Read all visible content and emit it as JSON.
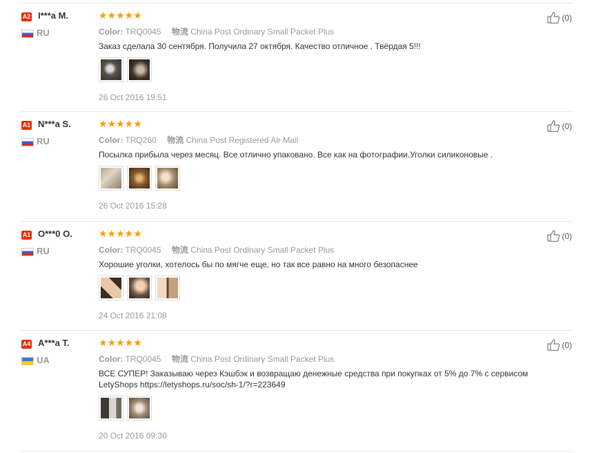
{
  "reviews": [
    {
      "badge": "A2",
      "buyer": "I***a M.",
      "country": "RU",
      "stars": "★★★★★",
      "color_label": "Color:",
      "color_value": "TRQ0045",
      "logistics_label": "物流",
      "logistics_value": "China Post Ordinary Small Packet Plus",
      "comment": "Заказ сделала 30 сентября. Получила 27 октября. Качество отличное . Твёрдая 5!!!",
      "date": "26 Oct 2016 19:51",
      "likes": "(0)"
    },
    {
      "badge": "A1",
      "buyer": "N***a S.",
      "country": "RU",
      "stars": "★★★★★",
      "color_label": "Color:",
      "color_value": "TRQ260",
      "logistics_label": "物流",
      "logistics_value": "China Post Registered Air Mail",
      "comment": "Посылка прибыла через месяц. Все отлично упаковано. Все как на фотографии.Уголки силиконовые .",
      "date": "26 Oct 2016 15:28",
      "likes": "(0)"
    },
    {
      "badge": "A1",
      "buyer": "O***0 O.",
      "country": "RU",
      "stars": "★★★★★",
      "color_label": "Color:",
      "color_value": "TRQ0045",
      "logistics_label": "物流",
      "logistics_value": "China Post Ordinary Small Packet Plus",
      "comment": "Хорошие уголки, хотелось бы по мягче еще, но так все равно на много безопаснее",
      "date": "24 Oct 2016 21:08",
      "likes": "(0)"
    },
    {
      "badge": "A4",
      "buyer": "A***a T.",
      "country": "UA",
      "stars": "★★★★★",
      "color_label": "Color:",
      "color_value": "TRQ0045",
      "logistics_label": "物流",
      "logistics_value": "China Post Ordinary Small Packet Plus",
      "comment": "ВСЕ СУПЕР! Заказываю через Кэшбэк и возвращаю денежные средства при покупках от 5% до 7% с сервисом LetyShops https://letyshops.ru/soc/sh-1/?r=223649",
      "date": "20 Oct 2016 09:30",
      "likes": "(0)"
    }
  ]
}
